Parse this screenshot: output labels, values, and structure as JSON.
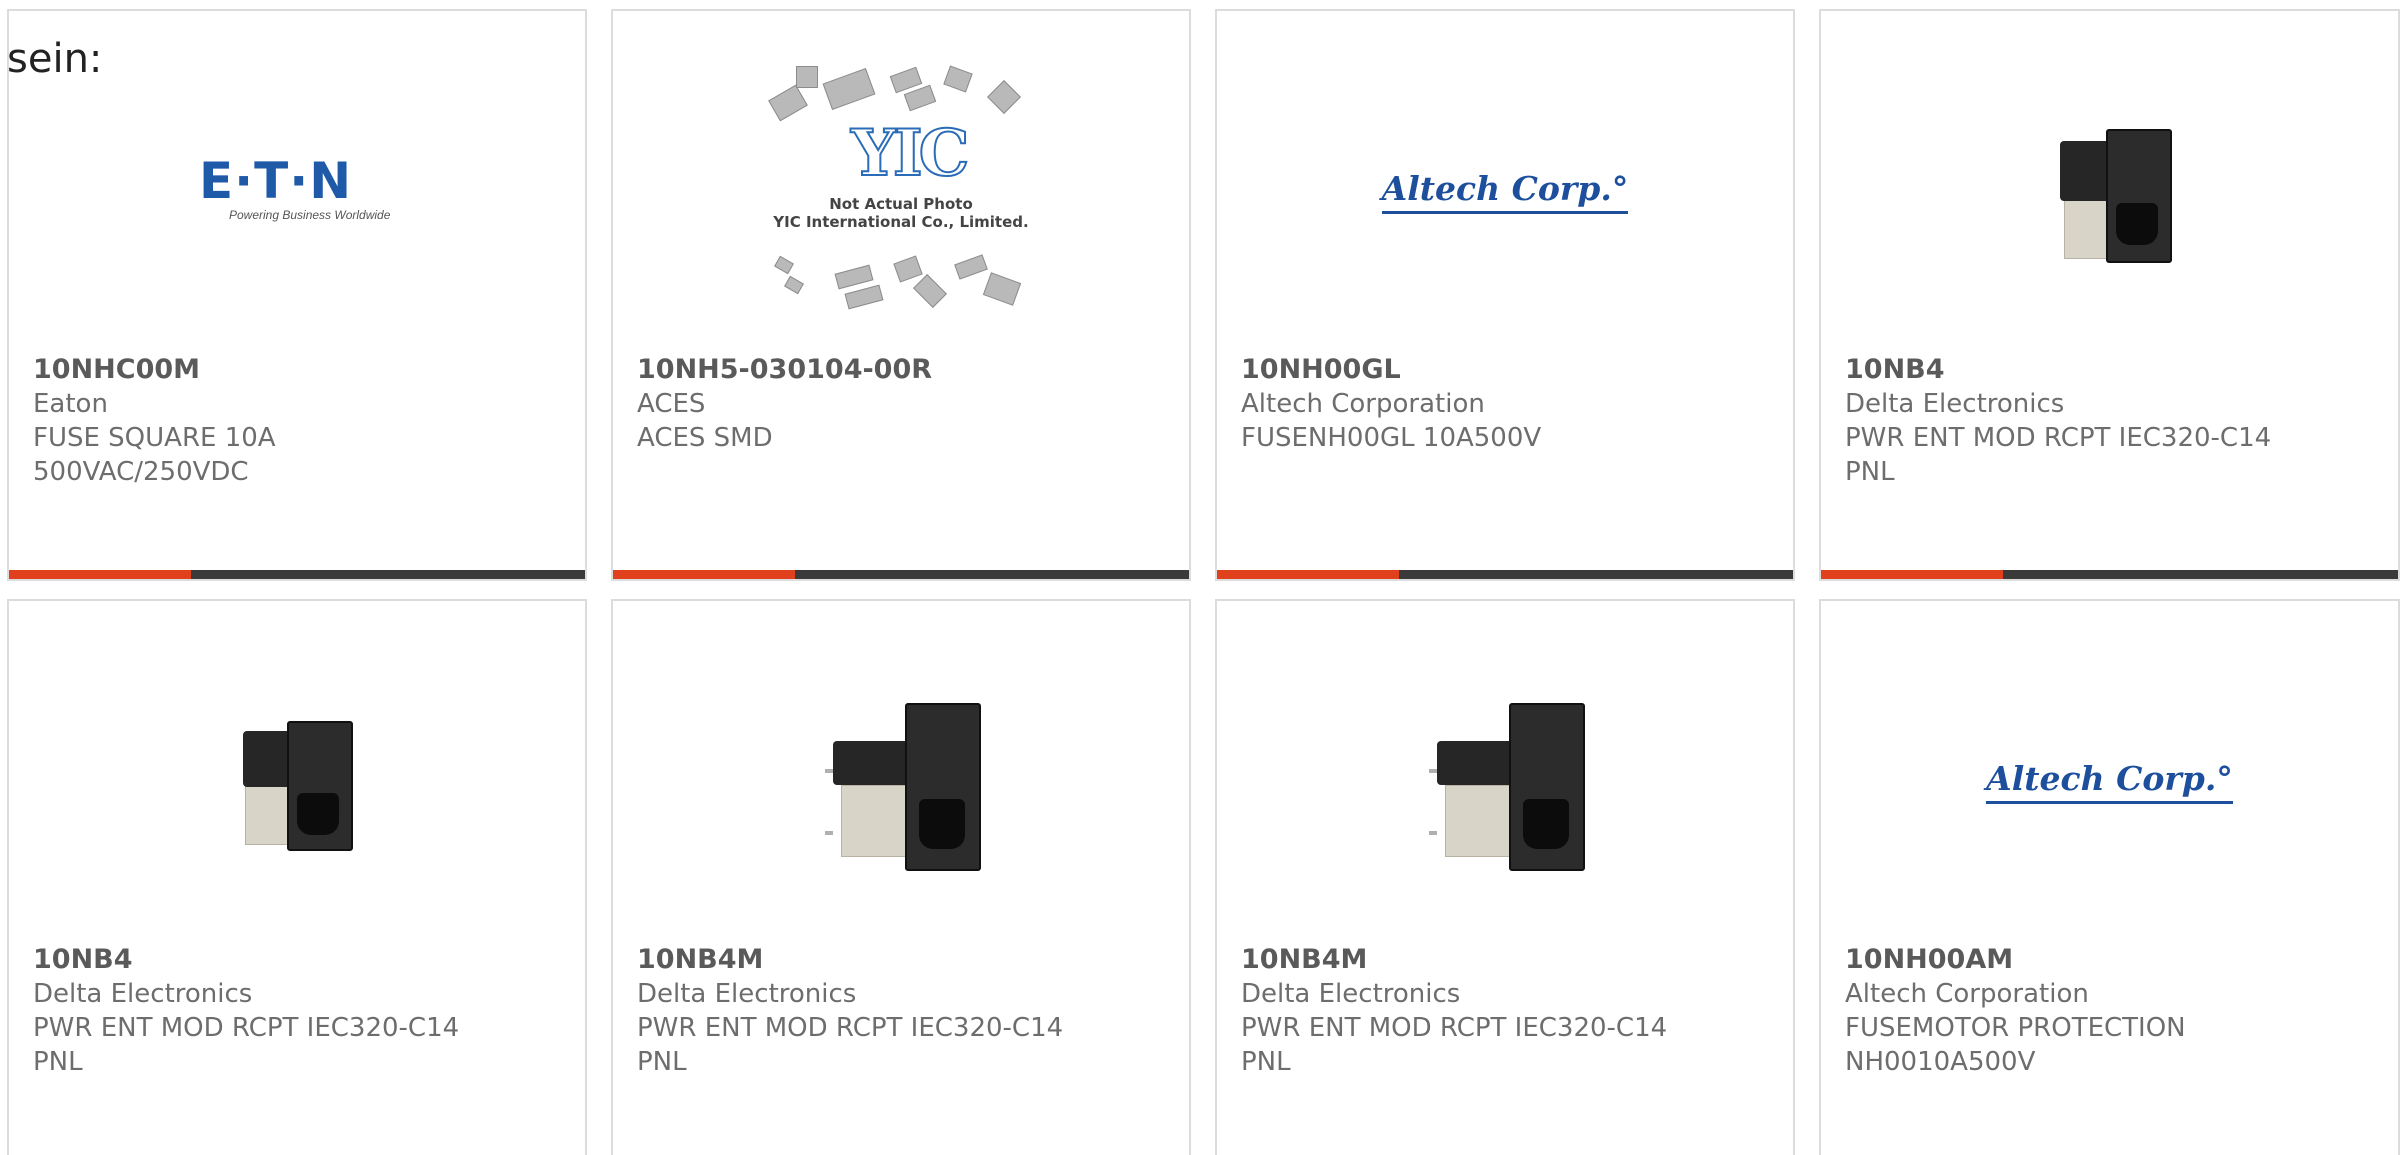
{
  "lead_text": "sein:",
  "products": [
    {
      "part_number": "10NHC00M",
      "manufacturer": "Eaton",
      "description_line1": "FUSE SQUARE 10A",
      "description_line2": "500VAC/250VDC",
      "image": "eaton-logo",
      "logo_text": "E·T·N",
      "logo_tagline": "Powering Business Worldwide"
    },
    {
      "part_number": "10NH5-030104-00R",
      "manufacturer": "ACES",
      "description_line1": "ACES SMD",
      "description_line2": "",
      "image": "yic-not-actual-photo",
      "logo_text": "YIC",
      "caption1": "Not Actual Photo",
      "caption2": "YIC International Co., Limited."
    },
    {
      "part_number": "10NH00GL",
      "manufacturer": "Altech Corporation",
      "description_line1": "FUSENH00GL 10A500V",
      "description_line2": "",
      "image": "altech-logo",
      "logo_text": "Altech Corp.°"
    },
    {
      "part_number": "10NB4",
      "manufacturer": "Delta Electronics",
      "description_line1": "PWR ENT MOD RCPT IEC320-C14",
      "description_line2": "PNL",
      "image": "power-entry-module-photo"
    },
    {
      "part_number": "10NB4",
      "manufacturer": "Delta Electronics",
      "description_line1": "PWR ENT MOD RCPT IEC320-C14",
      "description_line2": "PNL",
      "image": "power-entry-module-photo"
    },
    {
      "part_number": "10NB4M",
      "manufacturer": "Delta Electronics",
      "description_line1": "PWR ENT MOD RCPT IEC320-C14",
      "description_line2": "PNL",
      "image": "power-entry-module-photo"
    },
    {
      "part_number": "10NB4M",
      "manufacturer": "Delta Electronics",
      "description_line1": "PWR ENT MOD RCPT IEC320-C14",
      "description_line2": "PNL",
      "image": "power-entry-module-photo"
    },
    {
      "part_number": "10NH00AM",
      "manufacturer": "Altech Corporation",
      "description_line1": "FUSEMOTOR PROTECTION",
      "description_line2": "NH0010A500V",
      "image": "altech-logo",
      "logo_text": "Altech Corp.°"
    }
  ],
  "colors": {
    "accent_bar": "#e0401c",
    "bar_dark": "#3a3a3a",
    "card_border": "#dcdcdc",
    "text_gray": "#6d6d6d",
    "logo_blue": "#1e5aa8"
  }
}
